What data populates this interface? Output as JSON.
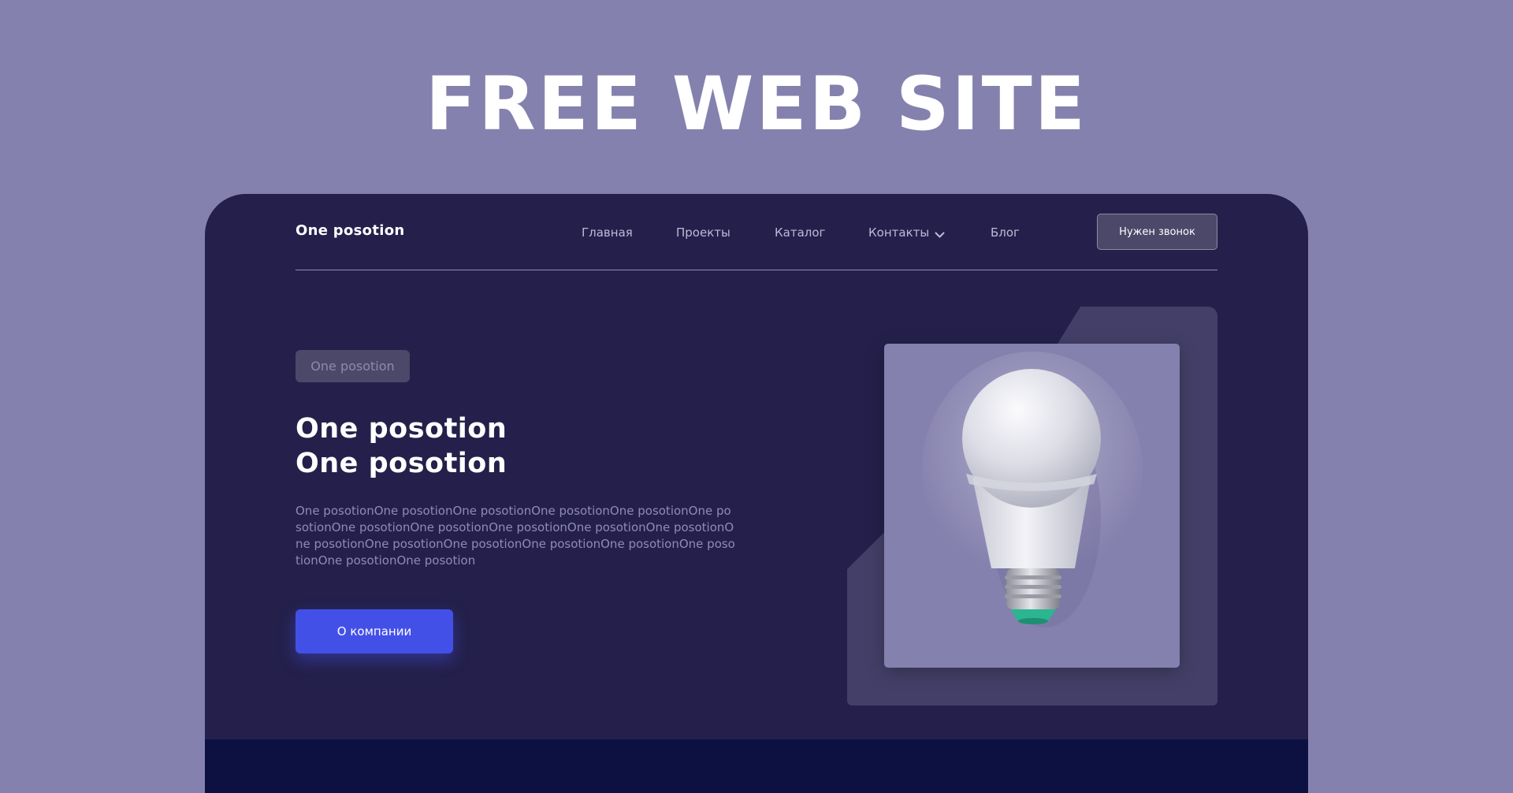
{
  "banner": {
    "title": "FREE WEB SITE"
  },
  "header": {
    "logo": "One posotion",
    "nav": [
      {
        "label": "Главная"
      },
      {
        "label": "Проекты"
      },
      {
        "label": "Каталог"
      },
      {
        "label": "Контакты"
      },
      {
        "label": "Блог"
      }
    ],
    "call_button": "Нужен звонок"
  },
  "hero": {
    "tag": "One posotion",
    "title_line1": "One posotion",
    "title_line2": "One posotion",
    "description": "One posotionOne posotionOne posotionOne posotionOne posotionOne posotionOne posotionOne posotionOne posotionOne posotionOne posotionOne posotionOne posotionOne posotionOne posotionOne posotionOne posotionOne posotionOne posotion",
    "cta_label": "О компании"
  },
  "colors": {
    "page_background": "#8581ae",
    "site_background": "#24204b",
    "accent": "#4350e8",
    "footer_band": "#0c1142"
  },
  "icons": {
    "dropdown": "chevron-down-icon",
    "hero_image": "light-bulb"
  }
}
